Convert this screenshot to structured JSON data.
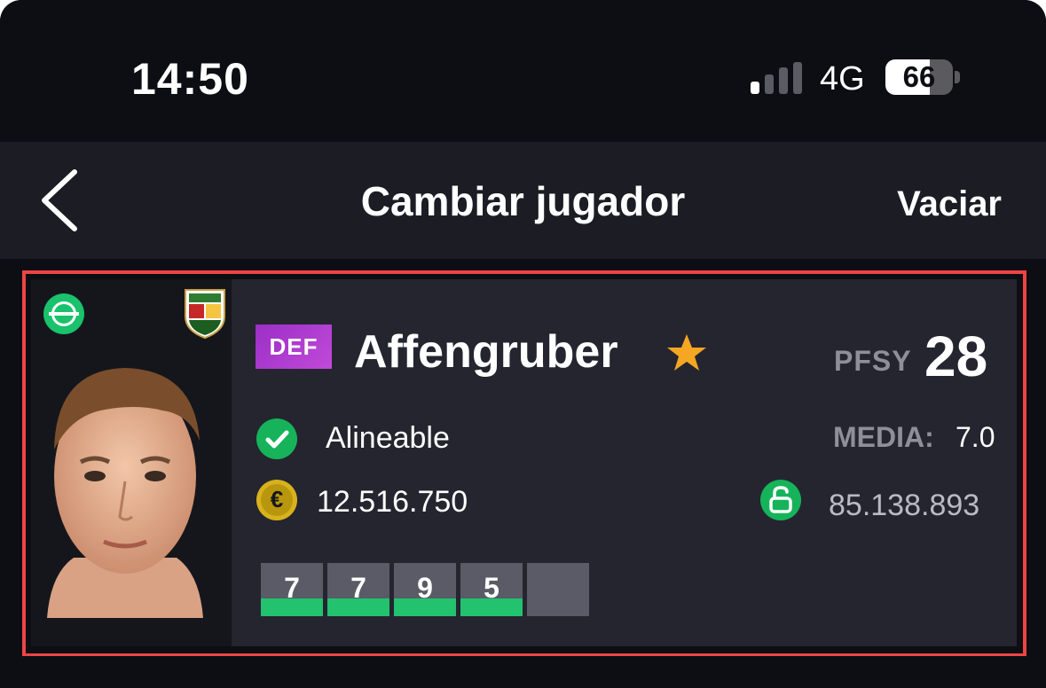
{
  "status_bar": {
    "time": "14:50",
    "network": "4G",
    "battery": "66",
    "battery_level": 0.66
  },
  "nav": {
    "title": "Cambiar jugador",
    "action": "Vaciar",
    "back_icon": "chevron-left-icon"
  },
  "player": {
    "position": "DEF",
    "name": "Affengruber",
    "pfsy_label": "PFSY",
    "pfsy_value": "28",
    "status": "Alineable",
    "media_label": "MEDIA:",
    "media_value": "7.0",
    "price": "12.516.750",
    "clause_value": "85.138.893",
    "icons": {
      "status": "status-circle-icon",
      "club": "club-crest-icon",
      "favorite": "star-icon",
      "availability": "check-icon",
      "price": "euro-coin-icon",
      "clause": "unlock-icon"
    },
    "recent_scores": [
      "7",
      "7",
      "9",
      "5",
      ""
    ]
  },
  "colors": {
    "background": "#0d0e13",
    "navbar": "#1b1c24",
    "card": "#24252f",
    "highlight_border": "#ef4444",
    "green": "#22c26f",
    "position_badge": "#b03ad0",
    "star": "#f5a623"
  }
}
